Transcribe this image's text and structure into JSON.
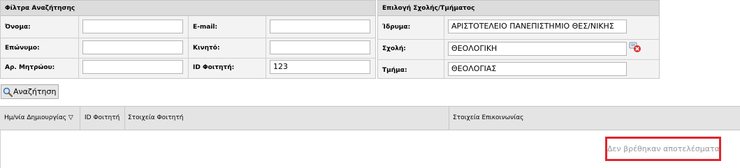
{
  "search_filters": {
    "title": "Φίλτρα Αναζήτησης",
    "fields": {
      "first_name": {
        "label": "Όνομα:",
        "value": ""
      },
      "last_name": {
        "label": "Επώνυμο:",
        "value": ""
      },
      "registry_number": {
        "label": "Αρ. Μητρώου:",
        "value": ""
      },
      "email": {
        "label": "E-mail:",
        "value": ""
      },
      "mobile": {
        "label": "Κινητό:",
        "value": ""
      },
      "student_id": {
        "label": "ID Φοιτητή:",
        "value": "123"
      }
    }
  },
  "school_selection": {
    "title": "Επιλογή Σχολής/Τμήματος",
    "institution": {
      "label": "Ίδρυμα:",
      "value": "ΑΡΙΣΤΟΤΕΛΕΙΟ ΠΑΝΕΠΙΣΤΗΜΙΟ ΘΕΣ/ΝΙΚΗΣ"
    },
    "school": {
      "label": "Σχολή:",
      "value": "ΘΕΟΛΟΓΙΚΗ"
    },
    "department": {
      "label": "Τμήμα:",
      "value": "ΘΕΟΛΟΓΙΑΣ"
    }
  },
  "search_button": {
    "label": "Αναζήτηση",
    "icon": "search-icon"
  },
  "results_grid": {
    "columns": [
      {
        "label": "Ημ/νία Δημιουργίας ▽"
      },
      {
        "label": "ID Φοιτητή"
      },
      {
        "label": "Στοιχεία Φοιτητή"
      },
      {
        "label": "Στοιχεία Επικοινωνίας"
      }
    ],
    "empty_message": "Δεν βρέθηκαν αποτελέσματα",
    "highlight_color": "#e0262c"
  }
}
